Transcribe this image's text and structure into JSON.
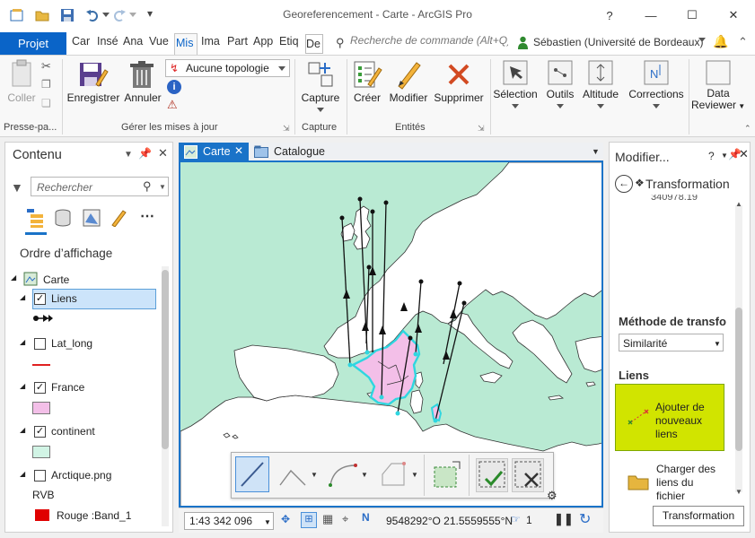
{
  "titlebar": {
    "title": "Georeferencement - Carte - ArcGIS Pro",
    "help": "?",
    "minimize": "—",
    "maximize": "☐",
    "close": "✕"
  },
  "ribbon_tabs": {
    "projet": "Projet",
    "tabs": [
      "Car",
      "Insé",
      "Ana",
      "Vue",
      "Mis",
      "Ima",
      "Part",
      "App",
      "Etiq",
      "De"
    ],
    "active_index": 4,
    "search_placeholder": "Recherche de commande (Alt+Q)",
    "user": "Sébastien (Université de Bordeaux)"
  },
  "ribbon": {
    "coller": "Coller",
    "presse_label": "Presse-pa...",
    "enregistrer": "Enregistrer",
    "annuler": "Annuler",
    "topologie": "Aucune topologie",
    "gerer_label": "Gérer les mises à jour",
    "capture": "Capture",
    "capture_label": "Capture",
    "creer": "Créer",
    "modifier": "Modifier",
    "supprimer": "Supprimer",
    "entites_label": "Entités",
    "selection": "Sélection",
    "outils": "Outils",
    "altitude": "Altitude",
    "corrections": "Corrections",
    "data_reviewer_1": "Data",
    "data_reviewer_2": "Reviewer"
  },
  "contents": {
    "title": "Contenu",
    "search_placeholder": "Rechercher",
    "order_heading": "Ordre d’affichage",
    "map_name": "Carte",
    "layers": [
      {
        "name": "Liens",
        "checked": true,
        "selected": true
      },
      {
        "name": "Lat_long",
        "checked": false
      },
      {
        "name": "France",
        "checked": true
      },
      {
        "name": "continent",
        "checked": true
      },
      {
        "name": "Arctique.png",
        "checked": false
      }
    ],
    "rvb_label": "RVB",
    "band_label": "Rouge :Band_1",
    "colors": {
      "france": "#f3bfe8",
      "continent": "#d1f4e5",
      "latlong": "#e02020",
      "band": "#e00000"
    }
  },
  "map_tabs": {
    "carte": "Carte",
    "catalogue": "Catalogue"
  },
  "status": {
    "scale": "1:43 342 096",
    "coords": "9548292°O 21.5559555°N",
    "selection_count": "1"
  },
  "right_pane": {
    "title": "Modifier...",
    "subtitle": "Transformation",
    "truncated_value": "340978.19",
    "method_heading": "Méthode de transfo",
    "method_value": "Similarité",
    "links_heading": "Liens",
    "add_links": [
      "Ajouter de",
      "nouveaux",
      "liens"
    ],
    "load_links": [
      "Charger des",
      "liens du",
      "fichier"
    ],
    "transformation_button": "Transformation",
    "accent": "#d1e400"
  }
}
